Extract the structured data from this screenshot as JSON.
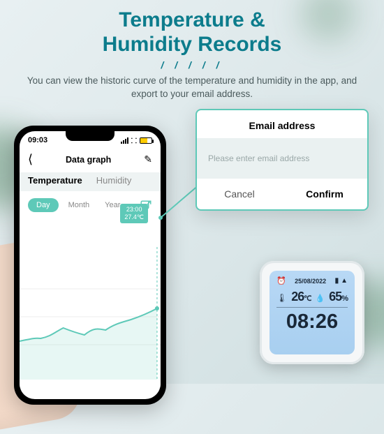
{
  "header": {
    "title_line1": "Temperature &",
    "title_line2": "Humidity Records",
    "divider": "/ / / / /",
    "subtitle": "You can view the historic curve of the temperature and  humidity in the app, and export to your email address."
  },
  "phone": {
    "time": "09:03",
    "screen_title": "Data graph",
    "tabs": {
      "active": "Temperature",
      "inactive": "Humidity"
    },
    "range": {
      "day": "Day",
      "month": "Month",
      "year": "Year"
    },
    "data_label_time": "23:00",
    "data_label_value": "27.4℃"
  },
  "popup": {
    "title": "Email address",
    "placeholder": "Please enter email address",
    "cancel": "Cancel",
    "confirm": "Confirm"
  },
  "device": {
    "date": "25/08/2022",
    "temperature": "26",
    "temperature_unit": "℃",
    "humidity": "65",
    "humidity_unit": "%",
    "clock": "08:26"
  },
  "chart_data": {
    "type": "line",
    "title": "Temperature",
    "x_unit": "hour-of-day",
    "y_unit": "℃",
    "series": [
      {
        "name": "Temperature",
        "points": [
          {
            "x": 0,
            "y": 25.2
          },
          {
            "x": 2,
            "y": 25.4
          },
          {
            "x": 4,
            "y": 25.3
          },
          {
            "x": 6,
            "y": 25.8
          },
          {
            "x": 8,
            "y": 26.3
          },
          {
            "x": 10,
            "y": 26.0
          },
          {
            "x": 12,
            "y": 25.7
          },
          {
            "x": 14,
            "y": 26.6
          },
          {
            "x": 16,
            "y": 26.4
          },
          {
            "x": 18,
            "y": 27.0
          },
          {
            "x": 20,
            "y": 27.2
          },
          {
            "x": 23,
            "y": 27.4
          }
        ]
      }
    ],
    "highlight": {
      "x": 23,
      "y": 27.4,
      "label_time": "23:00",
      "label_value": "27.4℃"
    },
    "ylim_estimate": [
      24,
      28
    ]
  }
}
